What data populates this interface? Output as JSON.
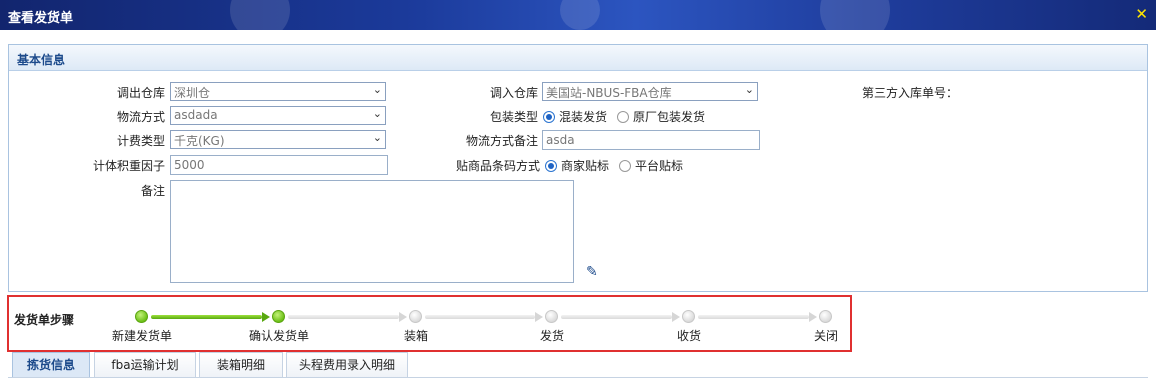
{
  "window": {
    "title": "查看发货单",
    "close_icon": "close-icon",
    "close_glyph": "✕"
  },
  "basic": {
    "section_title": "基本信息",
    "out_warehouse": {
      "label": "调出仓库",
      "value": "深圳仓"
    },
    "in_warehouse": {
      "label": "调入仓库",
      "value": "美国站-NBUS-FBA仓库"
    },
    "third_party_no": {
      "label": "第三方入库单号："
    },
    "logistics": {
      "label": "物流方式",
      "value": "asdada"
    },
    "packing": {
      "label": "包装类型",
      "options": [
        "混装发货",
        "原厂包装发货"
      ],
      "selected": "混装发货"
    },
    "billing": {
      "label": "计费类型",
      "value": "千克(KG)"
    },
    "logistics_note": {
      "label": "物流方式备注",
      "value": "asda"
    },
    "volume_factor": {
      "label": "计体积重因子",
      "value": "5000"
    },
    "barcode": {
      "label": "贴商品条码方式",
      "options": [
        "商家贴标",
        "平台贴标"
      ],
      "selected": "商家贴标"
    },
    "remark": {
      "label": "备注",
      "value": ""
    },
    "dropdown_glyph": "⌄",
    "pencil_glyph": "✎"
  },
  "steps": {
    "title": "发货单步骤",
    "items": [
      {
        "label": "新建发货单",
        "done": true
      },
      {
        "label": "确认发货单",
        "done": true
      },
      {
        "label": "装箱",
        "done": false
      },
      {
        "label": "发货",
        "done": false
      },
      {
        "label": "收货",
        "done": false
      },
      {
        "label": "关闭",
        "done": false
      }
    ]
  },
  "tabs": [
    {
      "label": "拣货信息",
      "active": true
    },
    {
      "label": "fba运输计划",
      "active": false
    },
    {
      "label": "装箱明细",
      "active": false
    },
    {
      "label": "头程费用录入明细",
      "active": false
    }
  ]
}
